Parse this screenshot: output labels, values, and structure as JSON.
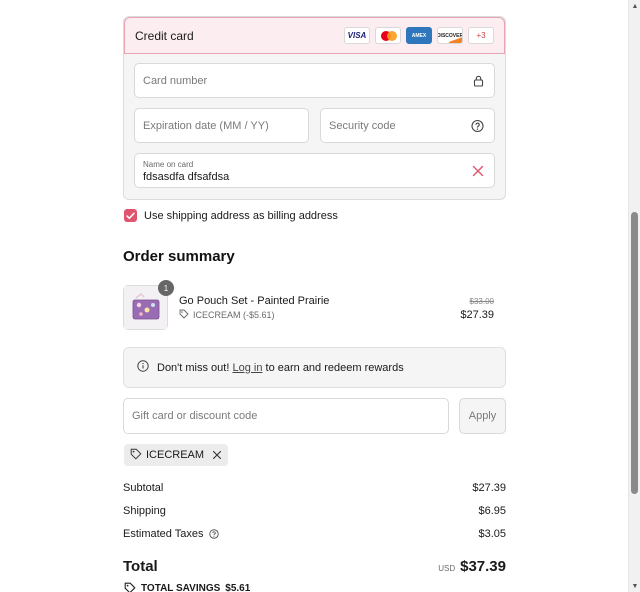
{
  "payment": {
    "method_title": "Credit card",
    "card_logos": [
      {
        "name": "visa",
        "label": "VISA"
      },
      {
        "name": "mastercard",
        "label": ""
      },
      {
        "name": "amex",
        "label": "AMEX"
      },
      {
        "name": "discover",
        "label": "DISCOVER"
      }
    ],
    "more_cards_label": "+3",
    "card_number_placeholder": "Card number",
    "expiration_placeholder": "Expiration date (MM / YY)",
    "security_code_placeholder": "Security code",
    "name_on_card_label": "Name on card",
    "name_on_card_value": "fdsasdfa dfsafdsa"
  },
  "billing": {
    "use_shipping_label": "Use shipping address as billing address",
    "checked": true
  },
  "order_summary": {
    "title": "Order summary",
    "items": [
      {
        "name": "Go Pouch Set - Painted Prairie",
        "quantity": "1",
        "discount_label": "ICECREAM (-$5.61)",
        "original_price": "$33.00",
        "price": "$27.39"
      }
    ],
    "rewards": {
      "prefix": "Don't miss out!",
      "link": "Log in",
      "suffix": "to earn and redeem rewards"
    },
    "discount_input_placeholder": "Gift card or discount code",
    "apply_label": "Apply",
    "applied_code": "ICECREAM",
    "subtotal_label": "Subtotal",
    "subtotal_value": "$27.39",
    "shipping_label": "Shipping",
    "shipping_value": "$6.95",
    "taxes_label": "Estimated Taxes",
    "taxes_value": "$3.05",
    "total_label": "Total",
    "total_currency": "USD",
    "total_value": "$37.39",
    "savings_label": "TOTAL SAVINGS",
    "savings_value": "$5.61"
  },
  "colors": {
    "accent": "#e0546d",
    "header_bg": "#fcedf0",
    "panel_bg": "#f5f5f5"
  }
}
